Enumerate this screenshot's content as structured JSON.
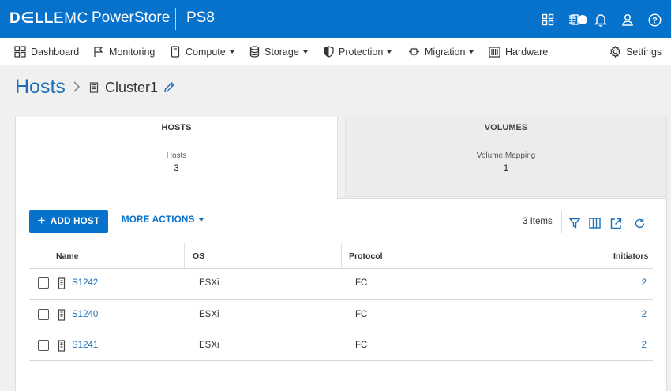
{
  "topbar": {
    "brand_primary": "D∈LL",
    "brand_secondary": "EMC",
    "product": "PowerStore",
    "system": "PS8",
    "icons": [
      "grid-icon",
      "jobs-icon",
      "bell-icon",
      "user-icon",
      "help-icon"
    ]
  },
  "nav": {
    "items": [
      {
        "label": "Dashboard",
        "icon": "dashboard-icon",
        "dropdown": false
      },
      {
        "label": "Monitoring",
        "icon": "flag-icon",
        "dropdown": false
      },
      {
        "label": "Compute",
        "icon": "compute-icon",
        "dropdown": true
      },
      {
        "label": "Storage",
        "icon": "database-icon",
        "dropdown": true
      },
      {
        "label": "Protection",
        "icon": "shield-icon",
        "dropdown": true
      },
      {
        "label": "Migration",
        "icon": "migration-icon",
        "dropdown": true
      },
      {
        "label": "Hardware",
        "icon": "hardware-icon",
        "dropdown": false
      }
    ],
    "settings_label": "Settings"
  },
  "breadcrumb": {
    "root": "Hosts",
    "current": "Cluster1"
  },
  "tiles": [
    {
      "title": "HOSTS",
      "label": "Hosts",
      "value": "3",
      "active": true
    },
    {
      "title": "VOLUMES",
      "label": "Volume Mapping",
      "value": "1",
      "active": false
    }
  ],
  "toolbar": {
    "add_label": "ADD HOST",
    "more_label": "MORE ACTIONS",
    "items_count": "3 Items"
  },
  "table": {
    "columns": [
      "Name",
      "OS",
      "Protocol",
      "Initiators"
    ],
    "rows": [
      {
        "name": "S1242",
        "os": "ESXi",
        "protocol": "FC",
        "initiators": "2"
      },
      {
        "name": "S1240",
        "os": "ESXi",
        "protocol": "FC",
        "initiators": "2"
      },
      {
        "name": "S1241",
        "os": "ESXi",
        "protocol": "FC",
        "initiators": "2"
      }
    ]
  },
  "colors": {
    "brand_blue": "#0672cb",
    "link_blue": "#1a6fb8",
    "page_bg": "#f0f0f0"
  }
}
